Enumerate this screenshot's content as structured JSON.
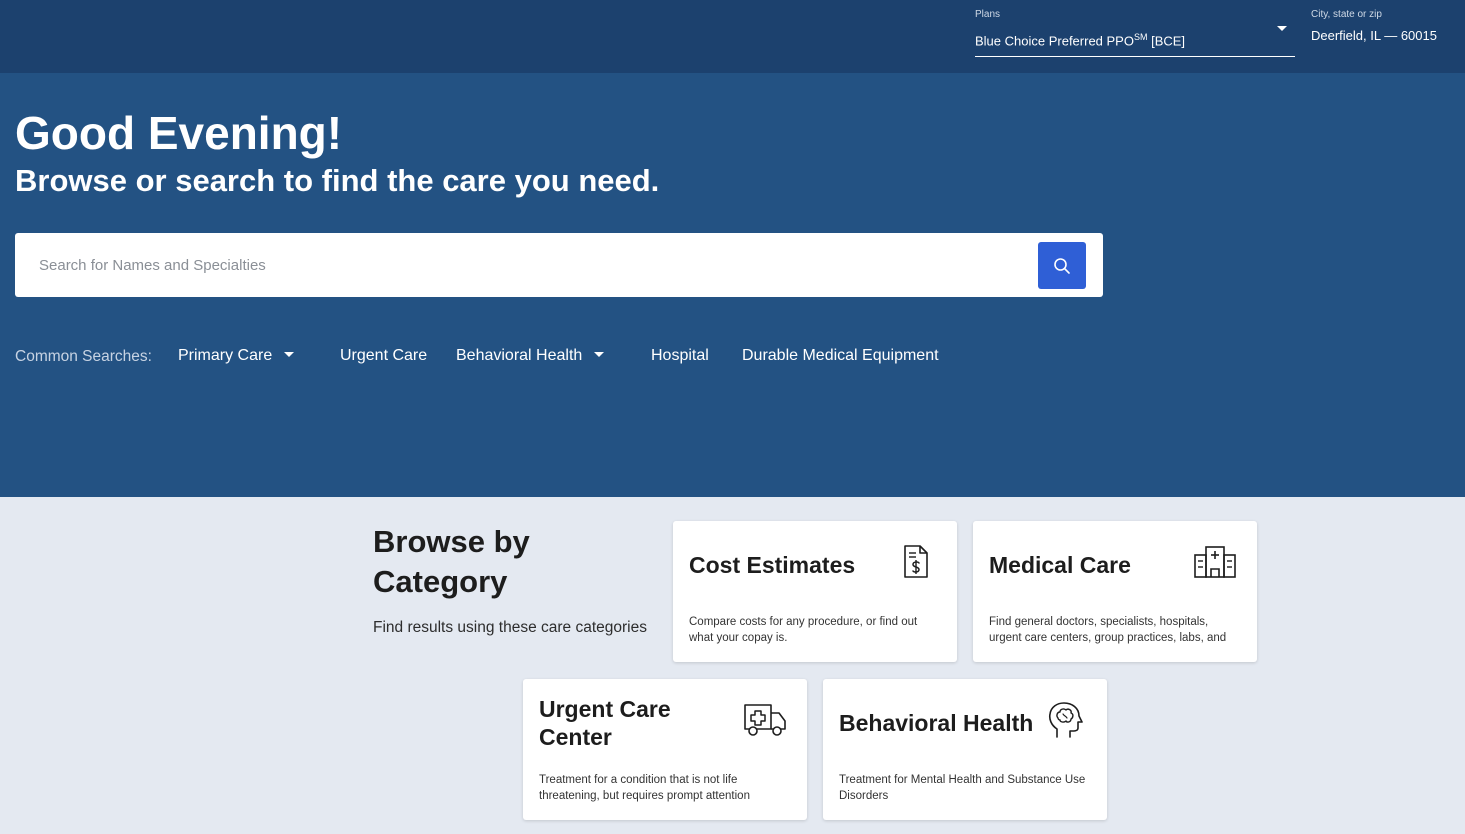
{
  "header": {
    "plans_label": "Plans",
    "plan_name": "Blue Choice Preferred PPO",
    "plan_sup": "SM",
    "plan_code": " [BCE]",
    "location_label": "City, state or zip",
    "location_value": "Deerfield, IL — 60015"
  },
  "hero": {
    "greeting": "Good Evening!",
    "subtitle": "Browse or search to find the care you need.",
    "search_placeholder": "Search for Names and Specialties"
  },
  "common_searches": {
    "label": "Common Searches:",
    "items": [
      {
        "label": "Primary Care"
      },
      {
        "label": "Urgent Care"
      },
      {
        "label": "Behavioral Health"
      },
      {
        "label": "Hospital"
      },
      {
        "label": "Durable Medical Equipment"
      }
    ]
  },
  "browse": {
    "title": "Browse by Category",
    "subtitle": "Find results using these care categories",
    "cards": [
      {
        "title": "Cost Estimates",
        "description": "Compare costs for any procedure, or find out what your copay is.",
        "icon": "dollar-document-icon"
      },
      {
        "title": "Medical Care",
        "description": "Find general doctors, specialists, hospitals, urgent care centers, group practices, labs, and more.",
        "icon": "hospital-building-icon"
      },
      {
        "title": "Urgent Care Center",
        "description": "Treatment for a condition that is not life threatening, but requires prompt attention",
        "icon": "ambulance-icon"
      },
      {
        "title": "Behavioral Health",
        "description": "Treatment for Mental Health and Substance Use Disorders",
        "icon": "brain-head-icon"
      }
    ]
  },
  "colors": {
    "topbar": "#1c416e",
    "hero": "#235283",
    "accent": "#2f5fd6",
    "page_background": "#e4e9f1"
  }
}
